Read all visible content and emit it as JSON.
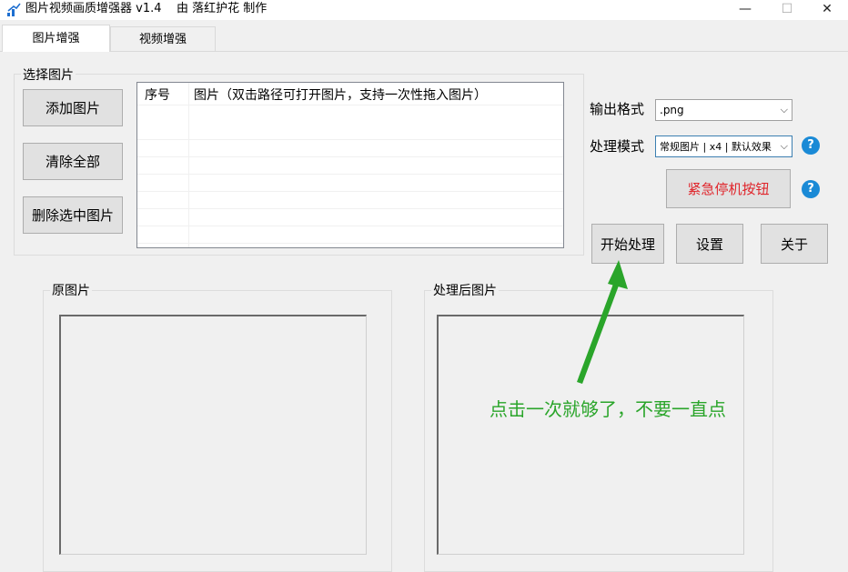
{
  "window": {
    "title": "图片视频画质增强器 v1.4    由 落红护花 制作",
    "minimize": "—",
    "maximize": "☐",
    "close": "✕"
  },
  "tabs": [
    {
      "label": "图片增强",
      "active": true
    },
    {
      "label": "视频增强",
      "active": false
    }
  ],
  "select_group": {
    "title": "选择图片",
    "add_button": "添加图片",
    "clear_button": "清除全部",
    "delete_button": "删除选中图片"
  },
  "list": {
    "columns": [
      "序号",
      "图片（双击路径可打开图片，支持一次性拖入图片）"
    ]
  },
  "settings": {
    "output_format_label": "输出格式",
    "output_format_value": ".png",
    "mode_label": "处理模式",
    "mode_value": "常规图片 | x4 | 默认效果",
    "help_glyph": "?",
    "stop_button": "紧急停机按钮",
    "stop_color": "#e0242a"
  },
  "actions": {
    "start_button": "开始处理",
    "settings_button": "设置",
    "about_button": "关于"
  },
  "preview": {
    "original_label": "原图片",
    "processed_label": "处理后图片"
  },
  "annotation": {
    "text": "点击一次就够了，不要一直点",
    "color": "#2aa52a"
  }
}
